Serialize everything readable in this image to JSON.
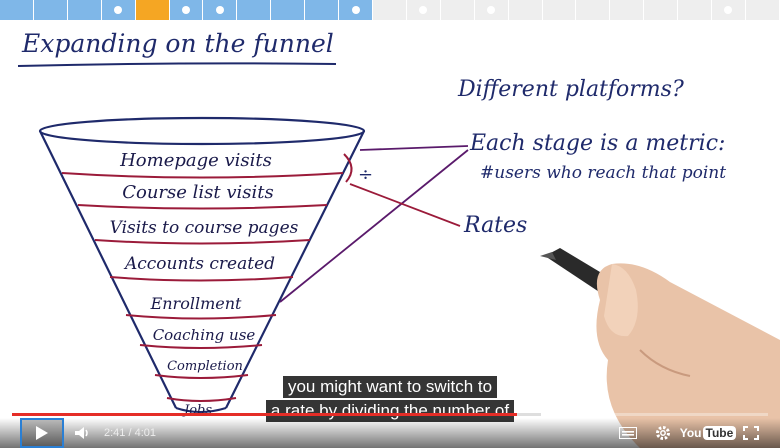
{
  "colors": {
    "seg_done": "#7fb7e8",
    "seg_current": "#f5a623",
    "seg_todo": "#f1f1f1",
    "ink": "#1f2a6b",
    "funnel_red": "#9b1b3a",
    "progress_red": "#e52d27"
  },
  "segments": [
    {
      "state": "done",
      "dot": false
    },
    {
      "state": "done",
      "dot": false
    },
    {
      "state": "done",
      "dot": false
    },
    {
      "state": "done",
      "dot": true
    },
    {
      "state": "current",
      "dot": false
    },
    {
      "state": "done",
      "dot": true
    },
    {
      "state": "done",
      "dot": true
    },
    {
      "state": "done",
      "dot": false
    },
    {
      "state": "done",
      "dot": false
    },
    {
      "state": "done",
      "dot": false
    },
    {
      "state": "done",
      "dot": true
    },
    {
      "state": "todo",
      "dot": false
    },
    {
      "state": "todo",
      "dot": true
    },
    {
      "state": "todo",
      "dot": false
    },
    {
      "state": "todo",
      "dot": true
    },
    {
      "state": "todo",
      "dot": false
    },
    {
      "state": "todo",
      "dot": false
    },
    {
      "state": "todo",
      "dot": false
    },
    {
      "state": "todo",
      "dot": false
    },
    {
      "state": "todo",
      "dot": false
    },
    {
      "state": "todo",
      "dot": false
    },
    {
      "state": "todo",
      "dot": true
    },
    {
      "state": "todo",
      "dot": false
    }
  ],
  "board": {
    "title": "Expanding on the funnel",
    "platforms_note": "Different platforms?",
    "metric_line1": "Each stage is a metric:",
    "metric_line2": "#users who reach that point",
    "rates_label": "Rates",
    "divide_symbol": "÷",
    "funnel_stages": [
      "Homepage visits",
      "Course list visits",
      "Visits to course pages",
      "Accounts created",
      "Enrollment",
      "Coaching use",
      "Completion",
      "Jobs"
    ]
  },
  "captions": {
    "line1": "you might want to switch to",
    "line2": "a rate by dividing the number of"
  },
  "player": {
    "current_time": "2:41",
    "separator": "/",
    "duration": "4:01",
    "progress_fraction": 0.668,
    "loaded_fraction": 0.7,
    "play_icon": "play-icon",
    "volume_icon": "volume-icon",
    "cc_icon": "captions-icon",
    "settings_icon": "gear-icon",
    "fullscreen_icon": "fullscreen-icon",
    "youtube_you": "You",
    "youtube_tube": "Tube"
  }
}
